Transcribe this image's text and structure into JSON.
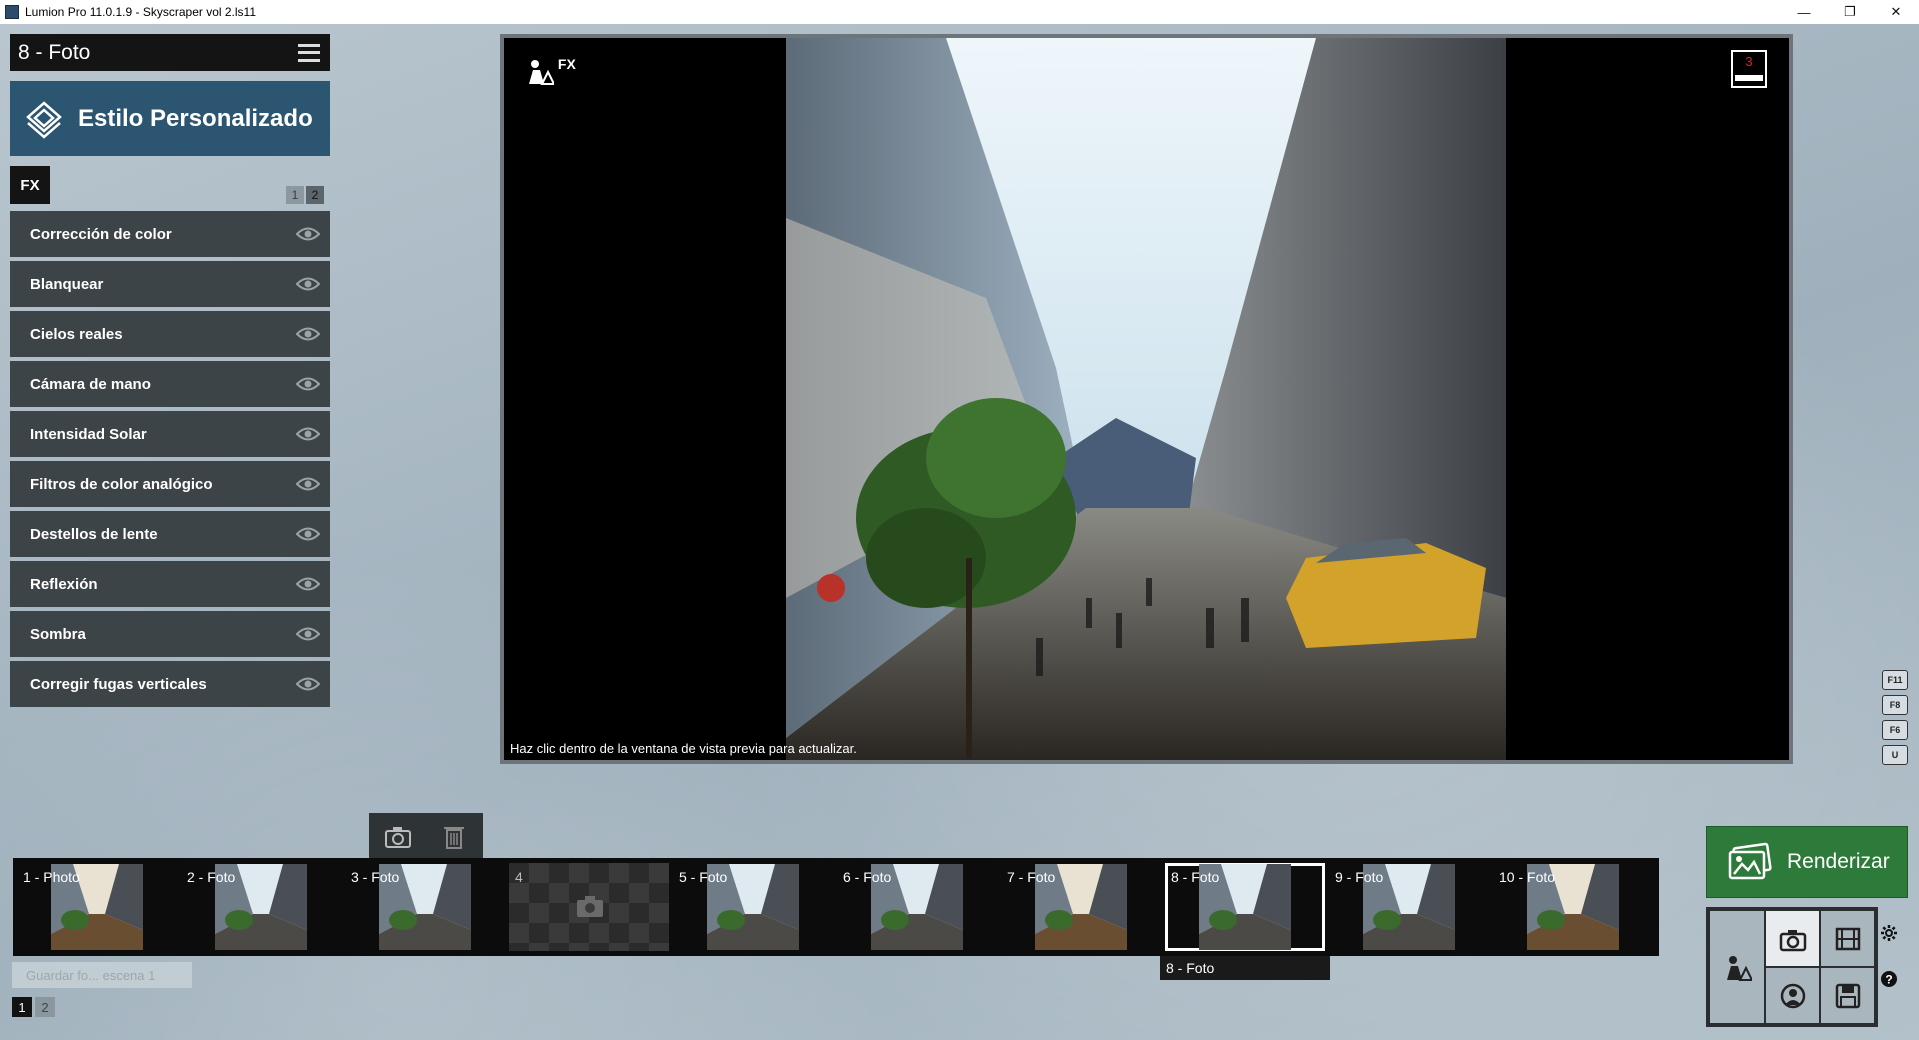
{
  "window": {
    "title": "Lumion Pro 11.0.1.9  - Skyscraper vol 2.ls11",
    "minimize_icon": "minimize-icon",
    "maximize_icon": "restore-icon",
    "close_icon": "close-icon"
  },
  "left_panel": {
    "header_title": "8 - Foto",
    "menu_icon": "hamburger-menu-icon",
    "style_button_label": "Estilo Personalizado",
    "fx_tab_label": "FX",
    "pages": [
      "1",
      "2"
    ],
    "active_page": "2",
    "effects": [
      {
        "label": "Corrección de color"
      },
      {
        "label": "Blanquear"
      },
      {
        "label": "Cielos reales"
      },
      {
        "label": "Cámara de mano"
      },
      {
        "label": "Intensidad Solar"
      },
      {
        "label": "Filtros de color analógico"
      },
      {
        "label": "Destellos de lente"
      },
      {
        "label": "Reflexión"
      },
      {
        "label": "Sombra"
      },
      {
        "label": "Corregir fugas verticales"
      }
    ]
  },
  "viewport": {
    "fx_label": "FX",
    "hint": "Haz clic dentro de la ventana de vista previa para actualizar.",
    "badge_value": "3"
  },
  "shortcut_keys": [
    "F11",
    "F8",
    "F6",
    "U"
  ],
  "filmstrip": {
    "slots": [
      {
        "label": "1 - Photo"
      },
      {
        "label": "2 - Foto"
      },
      {
        "label": "3 - Foto"
      },
      {
        "label": "4"
      },
      {
        "label": "5 - Foto"
      },
      {
        "label": "6 - Foto"
      },
      {
        "label": "7 - Foto"
      },
      {
        "label": "8 - Foto"
      },
      {
        "label": "9 - Foto"
      },
      {
        "label": "10 - Foto"
      }
    ],
    "selected_label": "8 - Foto",
    "add_button_label": "Guardar fo... escena 1",
    "pages": [
      "1",
      "2"
    ],
    "active_page": "1"
  },
  "render": {
    "label": "Renderizar"
  },
  "colors": {
    "accent_blue": "#2b5571",
    "render_green": "#2e7a3a",
    "panel_dark": "#3d4447",
    "badge_red": "#e02020"
  }
}
